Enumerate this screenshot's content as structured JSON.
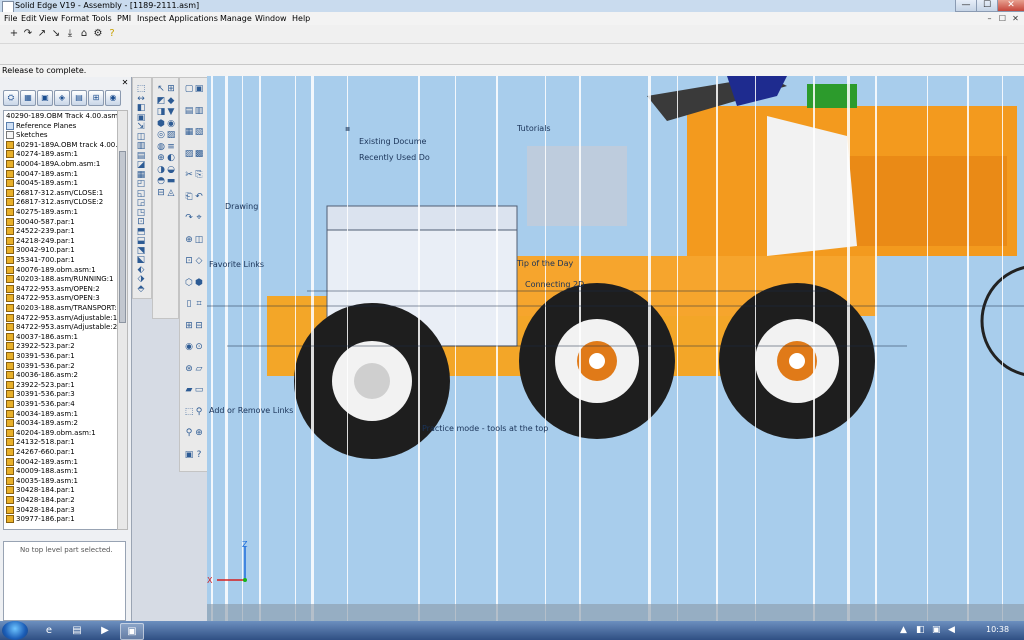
{
  "window": {
    "title": "Solid Edge V19 - Assembly - [1189-2111.asm]",
    "min_glyph": "—",
    "max_glyph": "☐",
    "close_glyph": "✕"
  },
  "menubar": {
    "items": [
      "File",
      "Edit",
      "View",
      "Format",
      "Tools",
      "PMI",
      "Inspect",
      "Applications",
      "Manage",
      "Window",
      "Help"
    ],
    "mdi_min": "–",
    "mdi_max": "☐",
    "mdi_close": "✕"
  },
  "toolbar": {
    "icons": [
      "+",
      "↷",
      "↗",
      "↘",
      "⤓",
      "⌂",
      "⚙",
      "?"
    ]
  },
  "prompt": {
    "text": "Release to complete."
  },
  "pathfinder": {
    "close_glyph": "✕",
    "tabs": [
      "⛭",
      "▦",
      "▣",
      "◈",
      "▤",
      "⊞",
      "◉",
      "▩"
    ],
    "tree": [
      {
        "label": "40290-189.OBM Track 4.00.asm:1",
        "icon": "none"
      },
      {
        "label": "Reference Planes",
        "icon": "plane"
      },
      {
        "label": "Sketches",
        "icon": "sketch"
      },
      {
        "label": "40291-189A.OBM track 4.00.asm:1",
        "icon": "part"
      },
      {
        "label": "40274-189.asm:1",
        "icon": "part"
      },
      {
        "label": "40004-189A.obm.asm:1",
        "icon": "part"
      },
      {
        "label": "40047-189.asm:1",
        "icon": "part"
      },
      {
        "label": "40045-189.asm:1",
        "icon": "part"
      },
      {
        "label": "26817-312.asm/CLOSE:1",
        "icon": "part"
      },
      {
        "label": "26817-312.asm/CLOSE:2",
        "icon": "part"
      },
      {
        "label": "40275-189.asm:1",
        "icon": "part"
      },
      {
        "label": "30040-587.par:1",
        "icon": "part"
      },
      {
        "label": "24522-239.par:1",
        "icon": "part"
      },
      {
        "label": "24218-249.par:1",
        "icon": "part"
      },
      {
        "label": "30042-910.par:1",
        "icon": "part"
      },
      {
        "label": "35341-700.par:1",
        "icon": "part"
      },
      {
        "label": "40076-189.obm.asm:1",
        "icon": "part"
      },
      {
        "label": "40203-188.asm/RUNNING:1",
        "icon": "part"
      },
      {
        "label": "84722-953.asm/OPEN:2",
        "icon": "part"
      },
      {
        "label": "84722-953.asm/OPEN:3",
        "icon": "part"
      },
      {
        "label": "40203-188.asm/TRANSPORT:1",
        "icon": "part"
      },
      {
        "label": "84722-953.asm/Adjustable:1",
        "icon": "part"
      },
      {
        "label": "84722-953.asm/Adjustable:2",
        "icon": "part"
      },
      {
        "label": "40037-186.asm:1",
        "icon": "part"
      },
      {
        "label": "23922-523.par:2",
        "icon": "part"
      },
      {
        "label": "30391-536.par:1",
        "icon": "part"
      },
      {
        "label": "30391-536.par:2",
        "icon": "part"
      },
      {
        "label": "40036-186.asm:2",
        "icon": "part"
      },
      {
        "label": "23922-523.par:1",
        "icon": "part"
      },
      {
        "label": "30391-536.par:3",
        "icon": "part"
      },
      {
        "label": "30391-536.par:4",
        "icon": "part"
      },
      {
        "label": "40034-189.asm:1",
        "icon": "part"
      },
      {
        "label": "40034-189.asm:2",
        "icon": "part"
      },
      {
        "label": "40204-189.obm.asm:1",
        "icon": "part"
      },
      {
        "label": "24132-518.par:1",
        "icon": "part"
      },
      {
        "label": "24267-660.par:1",
        "icon": "part"
      },
      {
        "label": "40042-189.asm:1",
        "icon": "part"
      },
      {
        "label": "40009-188.asm:1",
        "icon": "part"
      },
      {
        "label": "40035-189.asm:1",
        "icon": "part"
      },
      {
        "label": "30428-184.par:1",
        "icon": "part"
      },
      {
        "label": "30428-184.par:2",
        "icon": "part"
      },
      {
        "label": "30428-184.par:3",
        "icon": "part"
      },
      {
        "label": "30977-186.par:1",
        "icon": "part"
      }
    ],
    "details_text": "No top level part selected."
  },
  "vertical_toolbars": {
    "bar1": [
      "⬚",
      "↔",
      "◧",
      "▣",
      "⇲",
      "◫",
      "▥",
      "▤",
      "◪",
      "▦",
      "◰",
      "◱",
      "◲",
      "◳",
      "⊡",
      "⬒",
      "⬓",
      "⬔",
      "⬕",
      "⬖",
      "⬗",
      "⬘"
    ],
    "bar2": [
      "↖",
      "⊞",
      "◩",
      "◆",
      "◨",
      "▼",
      "⬢",
      "◉",
      "◎",
      "▨",
      "◍",
      "≡",
      "⊕",
      "◐",
      "◑",
      "◒",
      "◓",
      "▬",
      "⊟",
      "◬"
    ],
    "bar3": [
      "▢",
      "▣",
      "▤",
      "▥",
      "▦",
      "▧",
      "▨",
      "▩",
      "✂",
      "⎘",
      "⎗",
      "↶",
      "↷",
      "⌖",
      "⊕",
      "◫",
      "⊡",
      "◇",
      "⬡",
      "⬢",
      "▯",
      "⌗",
      "⊞",
      "⊟",
      "◉",
      "⊙",
      "⊛",
      "▱",
      "▰",
      "▭",
      "⬚",
      "⚲",
      "⚲",
      "⊕",
      "▣",
      "?"
    ]
  },
  "graphics": {
    "ghost_text": {
      "existing_document": "Existing Docume",
      "recently_used": "Recently Used Do",
      "tutorials": "Tutorials",
      "drawing": "Drawing",
      "favorite_links": "Favorite Links",
      "tip_of_day": "Tip of the Day",
      "connecting": "Connecting 2D",
      "add_remove_links": "Add or Remove Links",
      "practice_mode": "Practice mode - tools at the top"
    },
    "axis_x": "X",
    "axis_z": "Z"
  },
  "colors": {
    "background": "#a8cdec",
    "orange": "#f39a1e",
    "tire": "#1e1e1e",
    "hub": "#e07a18"
  },
  "taskbar": {
    "apps": [
      "e",
      "▤",
      "▶",
      "▣"
    ],
    "tray_icons": [
      "▲",
      "◧",
      "▣",
      "◀"
    ],
    "clock": "10:38"
  }
}
